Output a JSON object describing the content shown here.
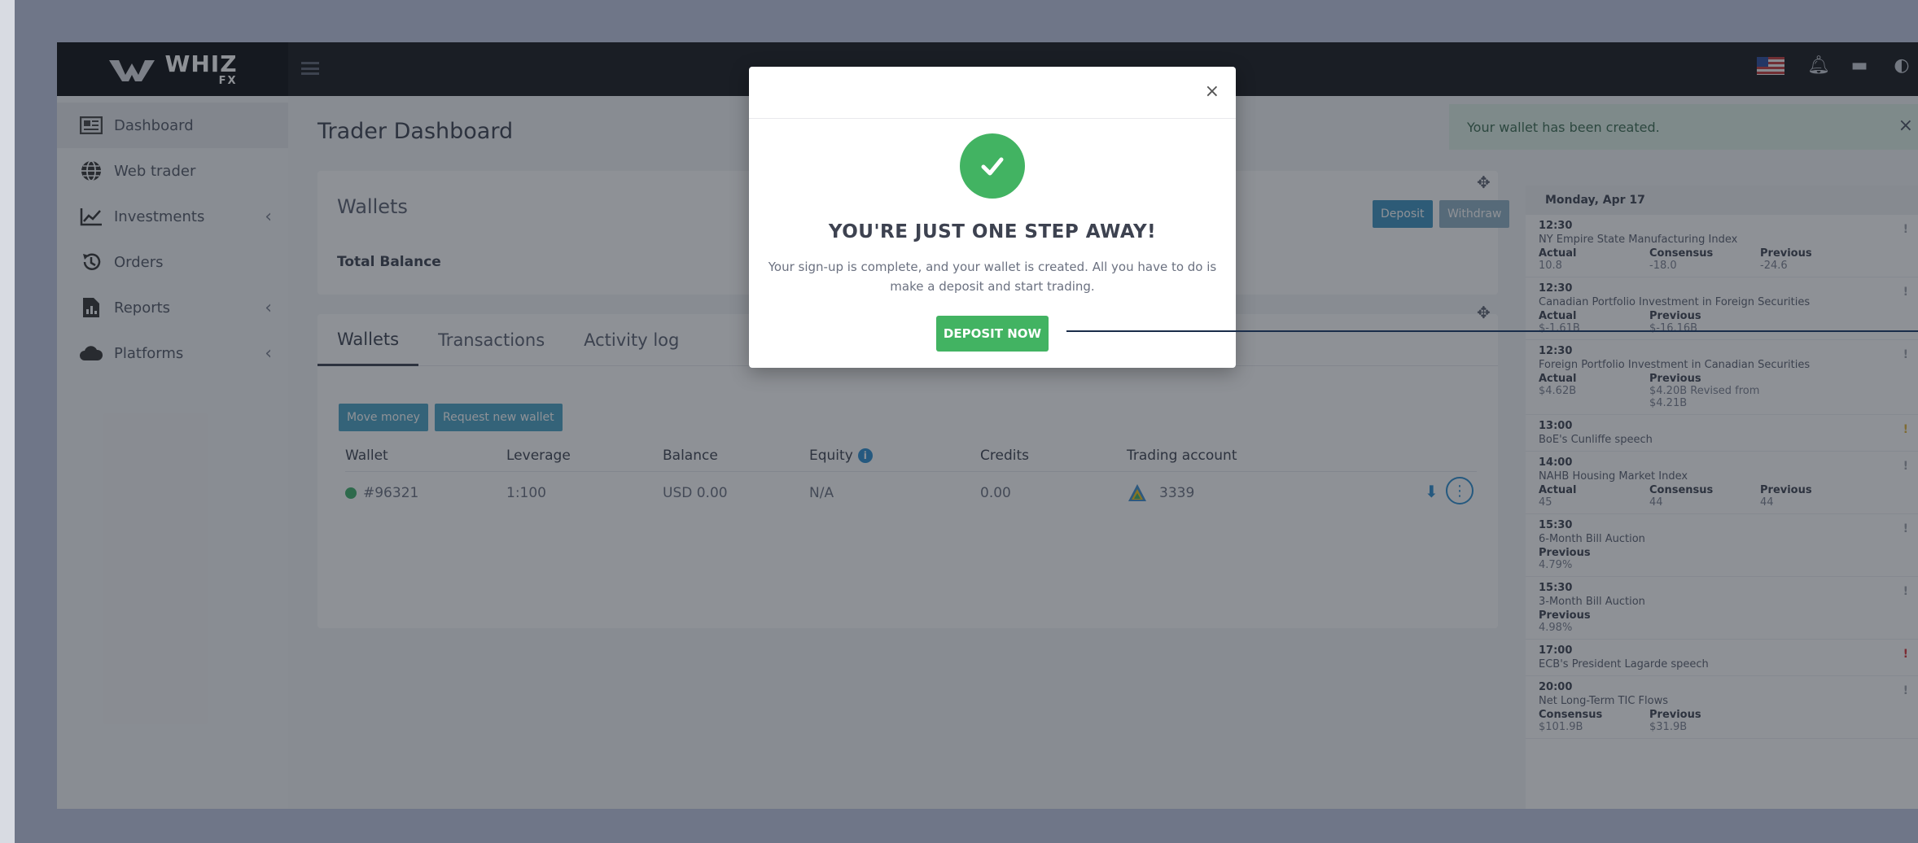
{
  "brand": {
    "word1": "WHIZ",
    "word2": "FX"
  },
  "sidebar": {
    "items": [
      {
        "label": "Dashboard",
        "icon": "dashboard-icon",
        "arrow": ""
      },
      {
        "label": "Web trader",
        "icon": "globe-icon",
        "arrow": ""
      },
      {
        "label": "Investments",
        "icon": "chart-line-icon",
        "arrow": "‹"
      },
      {
        "label": "Orders",
        "icon": "history-icon",
        "arrow": ""
      },
      {
        "label": "Reports",
        "icon": "file-chart-icon",
        "arrow": "‹"
      },
      {
        "label": "Platforms",
        "icon": "cloud-icon",
        "arrow": "‹"
      }
    ]
  },
  "main": {
    "page_title": "Trader Dashboard",
    "wallets_card": {
      "title": "Wallets",
      "total_balance_label": "Total Balance",
      "deposit_label": "Deposit",
      "withdraw_label": "Withdraw"
    },
    "tabs": [
      {
        "label": "Wallets"
      },
      {
        "label": "Transactions"
      },
      {
        "label": "Activity log"
      }
    ],
    "actions": {
      "move_money": "Move money",
      "request_wallet": "Request new wallet"
    },
    "wallet_table": {
      "headers": [
        "Wallet",
        "Leverage",
        "Balance",
        "Equity",
        "Credits",
        "Trading account"
      ],
      "row": {
        "wallet": "#96321",
        "leverage": "1:100",
        "balance": "USD 0.00",
        "equity": "N/A",
        "credits": "0.00",
        "trading_account": "3339"
      }
    }
  },
  "toast": {
    "message": "Your wallet has been created.",
    "close": "×"
  },
  "calendar": {
    "date": "Monday, Apr 17",
    "events": [
      {
        "time": "12:30",
        "title": "NY Empire State Manufacturing Index",
        "imp": "!",
        "imp_color": "#a0a4ad",
        "cols": [
          {
            "label": "Actual",
            "value": "10.8"
          },
          {
            "label": "Consensus",
            "value": "-18.0"
          },
          {
            "label": "Previous",
            "value": "-24.6"
          }
        ]
      },
      {
        "time": "12:30",
        "title": "Canadian Portfolio Investment in Foreign Securities",
        "imp": "!",
        "imp_color": "#a0a4ad",
        "cols": [
          {
            "label": "Actual",
            "value": "$-1.61B"
          },
          {
            "label": "Previous",
            "value": "$-16.16B"
          }
        ]
      },
      {
        "time": "12:30",
        "title": "Foreign Portfolio Investment in Canadian Securities",
        "imp": "!",
        "imp_color": "#a0a4ad",
        "cols": [
          {
            "label": "Actual",
            "value": "$4.62B"
          },
          {
            "label": "Previous",
            "value": "$4.20B Revised from $4.21B"
          }
        ]
      },
      {
        "time": "13:00",
        "title": "BoE's Cunliffe speech",
        "imp": "!",
        "imp_color": "#e0b43a",
        "cols": []
      },
      {
        "time": "14:00",
        "title": "NAHB Housing Market Index",
        "imp": "!",
        "imp_color": "#a0a4ad",
        "cols": [
          {
            "label": "Actual",
            "value": "45"
          },
          {
            "label": "Consensus",
            "value": "44"
          },
          {
            "label": "Previous",
            "value": "44"
          }
        ]
      },
      {
        "time": "15:30",
        "title": "6-Month Bill Auction",
        "imp": "!",
        "imp_color": "#a0a4ad",
        "cols": [
          {
            "label": "Previous",
            "value": "4.79%"
          }
        ]
      },
      {
        "time": "15:30",
        "title": "3-Month Bill Auction",
        "imp": "!",
        "imp_color": "#a0a4ad",
        "cols": [
          {
            "label": "Previous",
            "value": "4.98%"
          }
        ]
      },
      {
        "time": "17:00",
        "title": "ECB's President Lagarde speech",
        "imp": "!",
        "imp_color": "#d8343a",
        "cols": []
      },
      {
        "time": "20:00",
        "title": "Net Long-Term TIC Flows",
        "imp": "!",
        "imp_color": "#a0a4ad",
        "cols": [
          {
            "label": "Consensus",
            "value": "$101.9B"
          },
          {
            "label": "Previous",
            "value": "$31.9B"
          }
        ]
      }
    ]
  },
  "modal": {
    "close": "×",
    "title": "YOU'RE JUST ONE STEP AWAY!",
    "text": "Your sign-up is complete, and your wallet is created. All you have to do is make a deposit and start trading.",
    "button": "DEPOSIT NOW"
  },
  "colors": {
    "accent_green": "#42b362",
    "accent_blue": "#3c93c0",
    "dark_bar": "#16181d"
  }
}
